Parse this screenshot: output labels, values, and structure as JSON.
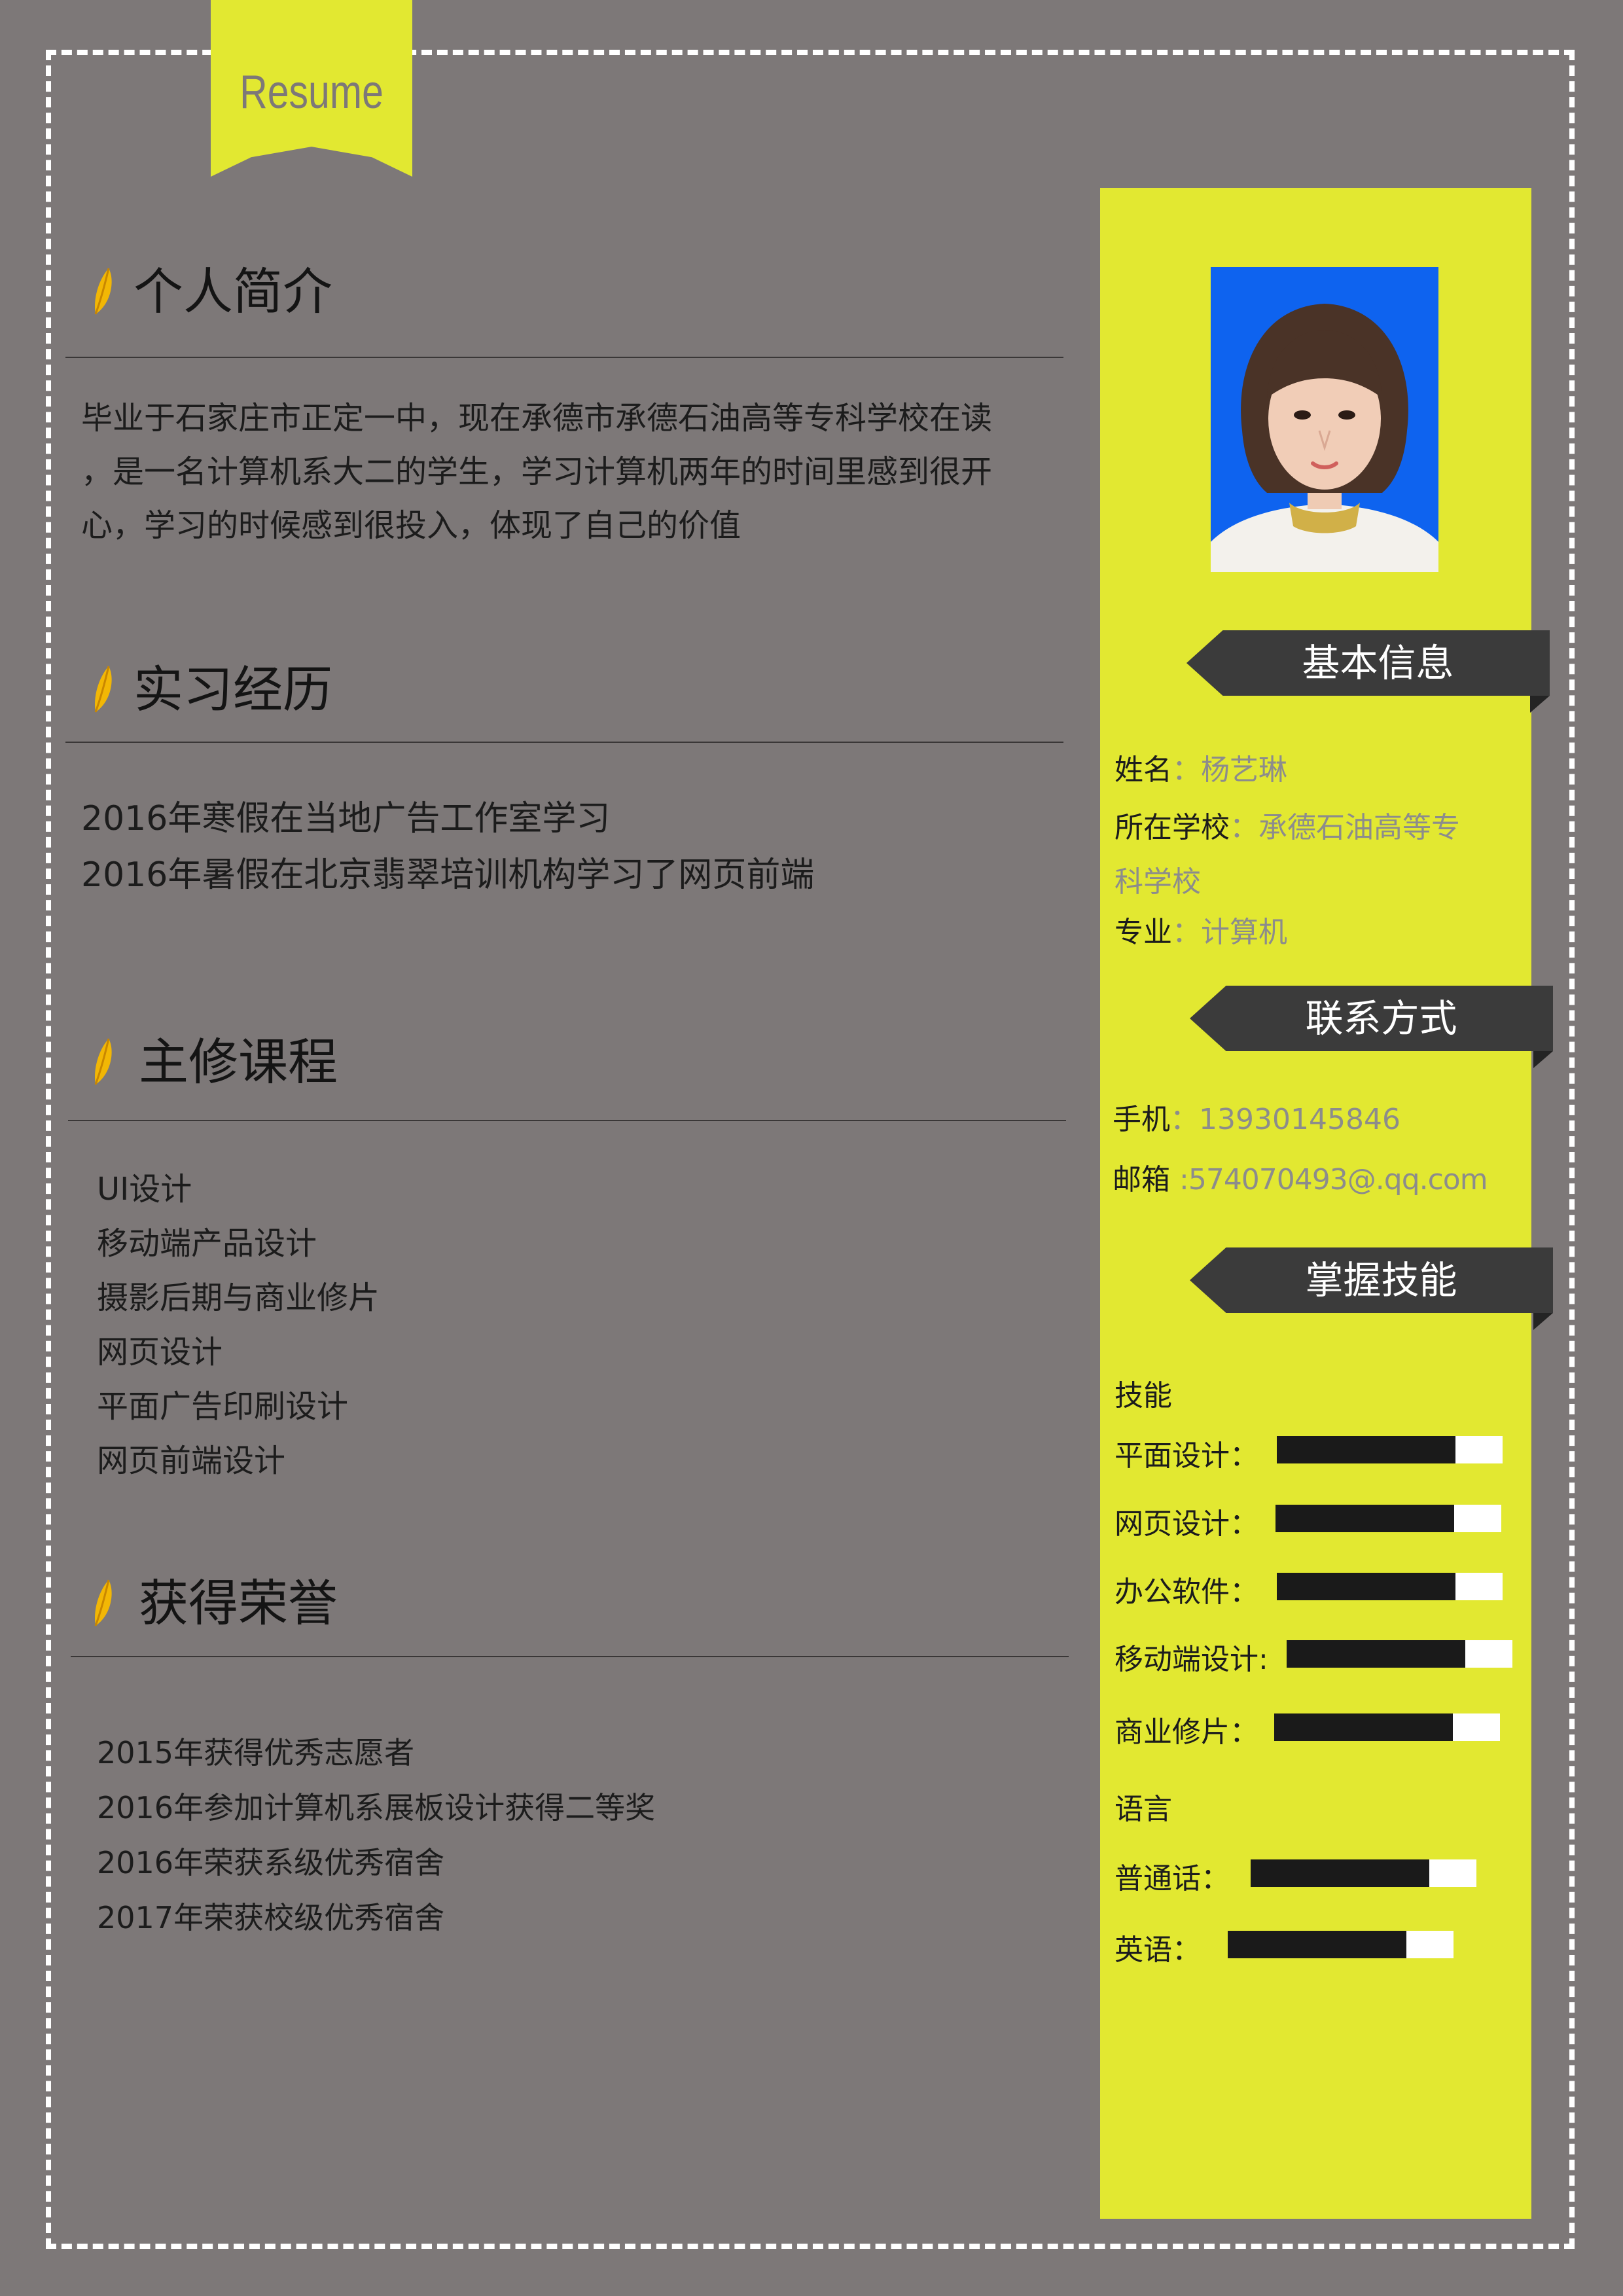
{
  "ribbon": {
    "label": "Resume"
  },
  "intro": {
    "title": "个人简介",
    "lines": [
      "毕业于石家庄市正定一中，现在承德市承德石油高等专科学校在读",
      "，是一名计算机系大二的学生，学习计算机两年的时间里感到很开",
      "心，学习的时候感到很投入，体现了自己的价值"
    ]
  },
  "internship": {
    "title": "实习经历",
    "items": [
      "2016年寒假在当地广告工作室学习",
      "2016年暑假在北京翡翠培训机构学习了网页前端"
    ]
  },
  "courses": {
    "title": "主修课程",
    "items": [
      "UI设计",
      "移动端产品设计",
      "摄影后期与商业修片",
      "网页设计",
      "平面广告印刷设计",
      "网页前端设计"
    ]
  },
  "honors": {
    "title": "获得荣誉",
    "items": [
      "2015年获得优秀志愿者",
      "2016年参加计算机系展板设计获得二等奖",
      "2016年荣获系级优秀宿舍",
      "2017年荣获校级优秀宿舍"
    ]
  },
  "basic_info": {
    "title": "基本信息",
    "name_label": "姓名",
    "name_value": "：杨艺琳",
    "school_label": "所在学校",
    "school_value_1": "：承德石油高等专",
    "school_value_2": "科学校",
    "major_label": "专业",
    "major_value": "：计算机"
  },
  "contact": {
    "title": "联系方式",
    "phone_label": "手机",
    "phone_value": "：13930145846",
    "email_label": "邮箱",
    "email_value": ":574070493@.qq.com"
  },
  "skills": {
    "title": "掌握技能",
    "skills_heading": "技能",
    "items": [
      {
        "label": "平面设计：",
        "level": 0.79
      },
      {
        "label": "网页设计：",
        "level": 0.79
      },
      {
        "label": "办公软件：",
        "level": 0.79
      },
      {
        "label": "移动端设计:",
        "level": 0.79
      },
      {
        "label": "商业修片：",
        "level": 0.79
      }
    ],
    "language_heading": "语言",
    "languages": [
      {
        "label": "普通话：",
        "level": 0.79
      },
      {
        "label": "英语：",
        "level": 0.79
      }
    ]
  },
  "colors": {
    "background": "#7d7878",
    "accent": "#e2e831",
    "tag": "#3b3b3b",
    "photo_background": "#0e63ef"
  },
  "icons": {
    "section_marker": "leaf-icon"
  }
}
